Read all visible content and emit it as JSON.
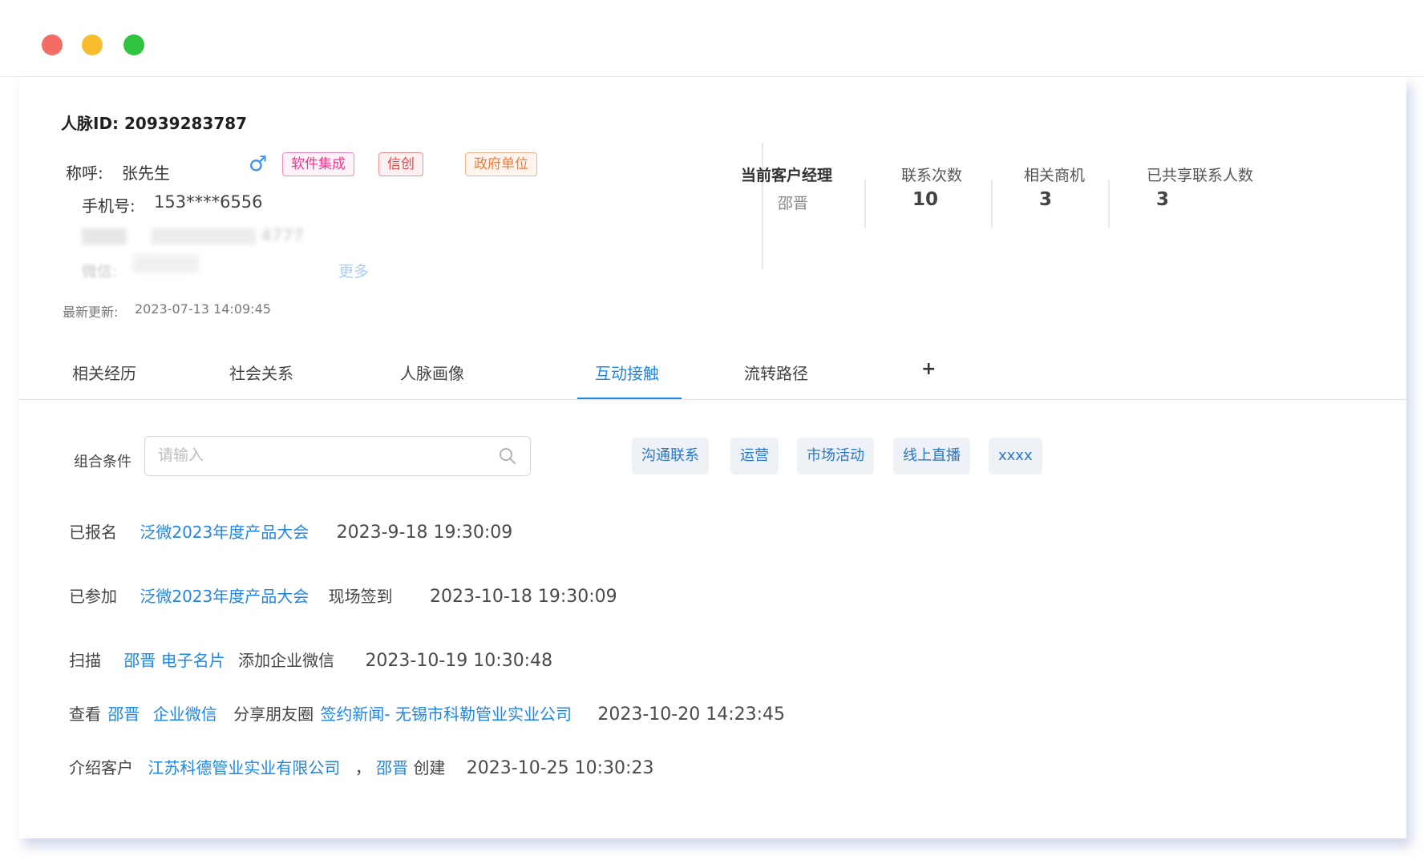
{
  "window": {
    "controls": [
      "close",
      "minimize",
      "maximize"
    ]
  },
  "profile": {
    "id_label": "人脉ID:",
    "id_value": "20939283787",
    "nickname_label": "称呼:",
    "nickname_value": "张先生",
    "gender_icon": "♂",
    "tags": [
      "软件集成",
      "信创",
      "政府单位"
    ],
    "phone_label": "手机号:",
    "phone_value": "153****6556",
    "blurred_value": "4777",
    "wechat_label": "微信:",
    "more_link": "更多",
    "update_label": "最新更新:",
    "update_value": "2023-07-13 14:09:45"
  },
  "stats": [
    {
      "label": "当前客户经理",
      "value": "邵晋"
    },
    {
      "label": "联系次数",
      "value": "10"
    },
    {
      "label": "相关商机",
      "value": "3"
    },
    {
      "label": "已共享联系人数",
      "value": "3"
    }
  ],
  "tabs": [
    {
      "label": "相关经历",
      "active": false
    },
    {
      "label": "社会关系",
      "active": false
    },
    {
      "label": "人脉画像",
      "active": false
    },
    {
      "label": "互动接触",
      "active": true
    },
    {
      "label": "流转路径",
      "active": false
    }
  ],
  "tab_add": "+",
  "filter": {
    "label": "组合条件",
    "placeholder": "请输入",
    "chips": [
      "沟通联系",
      "运营",
      "市场活动",
      "线上直播",
      "xxxx"
    ]
  },
  "records": [
    {
      "action": "已报名",
      "link": "泛微2023年度产品大会",
      "time": "2023-9-18 19:30:09"
    },
    {
      "action": "已参加",
      "link": "泛微2023年度产品大会",
      "detail": "现场签到",
      "time": "2023-10-18 19:30:09"
    },
    {
      "action": "扫描",
      "link": "邵晋 电子名片",
      "detail": "添加企业微信",
      "time": "2023-10-19 10:30:48"
    },
    {
      "action": "查看",
      "link1": "邵晋",
      "link2": "企业微信",
      "detail": "分享朋友圈",
      "link3": "签约新闻- 无锡市科勒管业实业公司",
      "time": "2023-10-20 14:23:45"
    },
    {
      "action": "介绍客户",
      "link": "江苏科德管业实业有限公司",
      "sep": "，",
      "link2": "邵晋",
      "detail": "创建",
      "time": "2023-10-25 10:30:23"
    }
  ],
  "colors": {
    "accent": "#1e86e9",
    "tag_software": "#eb3a8c",
    "tag_xinchuang": "#e84848",
    "tag_government": "#f1793a"
  }
}
